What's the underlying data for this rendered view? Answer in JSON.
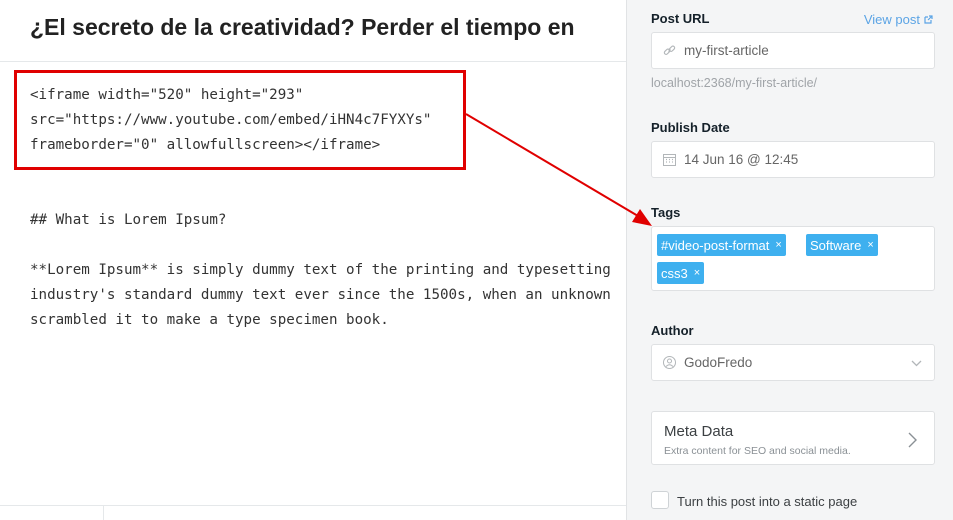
{
  "editor": {
    "title": "¿El secreto de la creatividad? Perder el tiempo en",
    "code_lines": [
      "<iframe width=\"520\" height=\"293\"",
      "src=\"https://www.youtube.com/embed/iHN4c7FYXYs\"",
      "frameborder=\"0\" allowfullscreen></iframe>"
    ],
    "heading": "## What is Lorem Ipsum?",
    "paragraph_lines": [
      "**Lorem Ipsum** is simply dummy text of the printing and typesetting",
      "industry's standard dummy text ever since the 1500s, when an unknown",
      "scrambled it to make a type specimen book."
    ]
  },
  "settings": {
    "post_url": {
      "label": "Post URL",
      "view_post": "View post",
      "value": "my-first-article",
      "hint": "localhost:2368/my-first-article/",
      "icon": "link-icon"
    },
    "publish_date": {
      "label": "Publish Date",
      "value": "14 Jun 16 @ 12:45",
      "icon": "calendar-icon"
    },
    "tags": {
      "label": "Tags",
      "items": [
        "#video-post-format",
        "Software",
        "css3"
      ],
      "remove_symbol": "×"
    },
    "author": {
      "label": "Author",
      "value": "GodoFredo",
      "icon": "user-icon"
    },
    "meta_data": {
      "title": "Meta Data",
      "subtitle": "Extra content for SEO and social media."
    },
    "static_page": {
      "label": "Turn this post into a static page",
      "checked": false
    }
  },
  "colors": {
    "annotation_red": "#e00000",
    "tag_blue": "#3eb0ef",
    "link_blue": "#5ba4e5",
    "panel_bg": "#f4f5f6"
  }
}
